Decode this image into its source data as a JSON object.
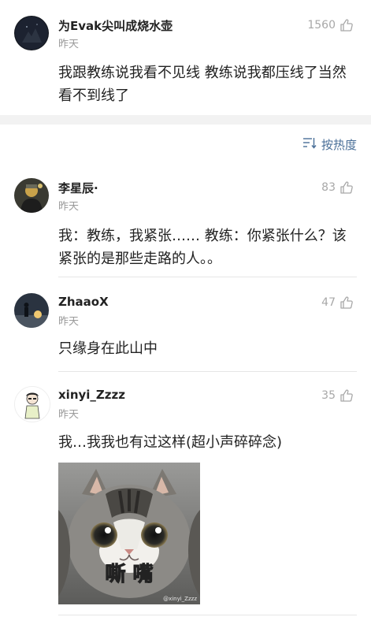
{
  "post": {
    "username": "为Evak尖叫成烧水壶",
    "time": "昨天",
    "likes": "1560",
    "content": "我跟教练说我看不见线 教练说我都压线了当然看不到线了"
  },
  "sort": {
    "label": "按热度",
    "icon": "sort-lines-icon"
  },
  "comments": [
    {
      "username": "李星辰·",
      "time": "昨天",
      "likes": "83",
      "content": "我：教练，我紧张…… 教练：你紧张什么？该紧张的是那些走路的人。。"
    },
    {
      "username": "ZhaaoX",
      "time": "昨天",
      "likes": "47",
      "content": "只缘身在此山中"
    },
    {
      "username": "xinyi_Zzzz",
      "time": "昨天",
      "likes": "35",
      "content": "我…我我也有过这样(超小声碎碎念)",
      "image_caption": "嘶 嘴",
      "image_watermark": "@xinyi_Zzzz"
    }
  ],
  "colors": {
    "link": "#4a6f98",
    "muted": "#9a9a9a",
    "separator": "#f2f2f2"
  }
}
